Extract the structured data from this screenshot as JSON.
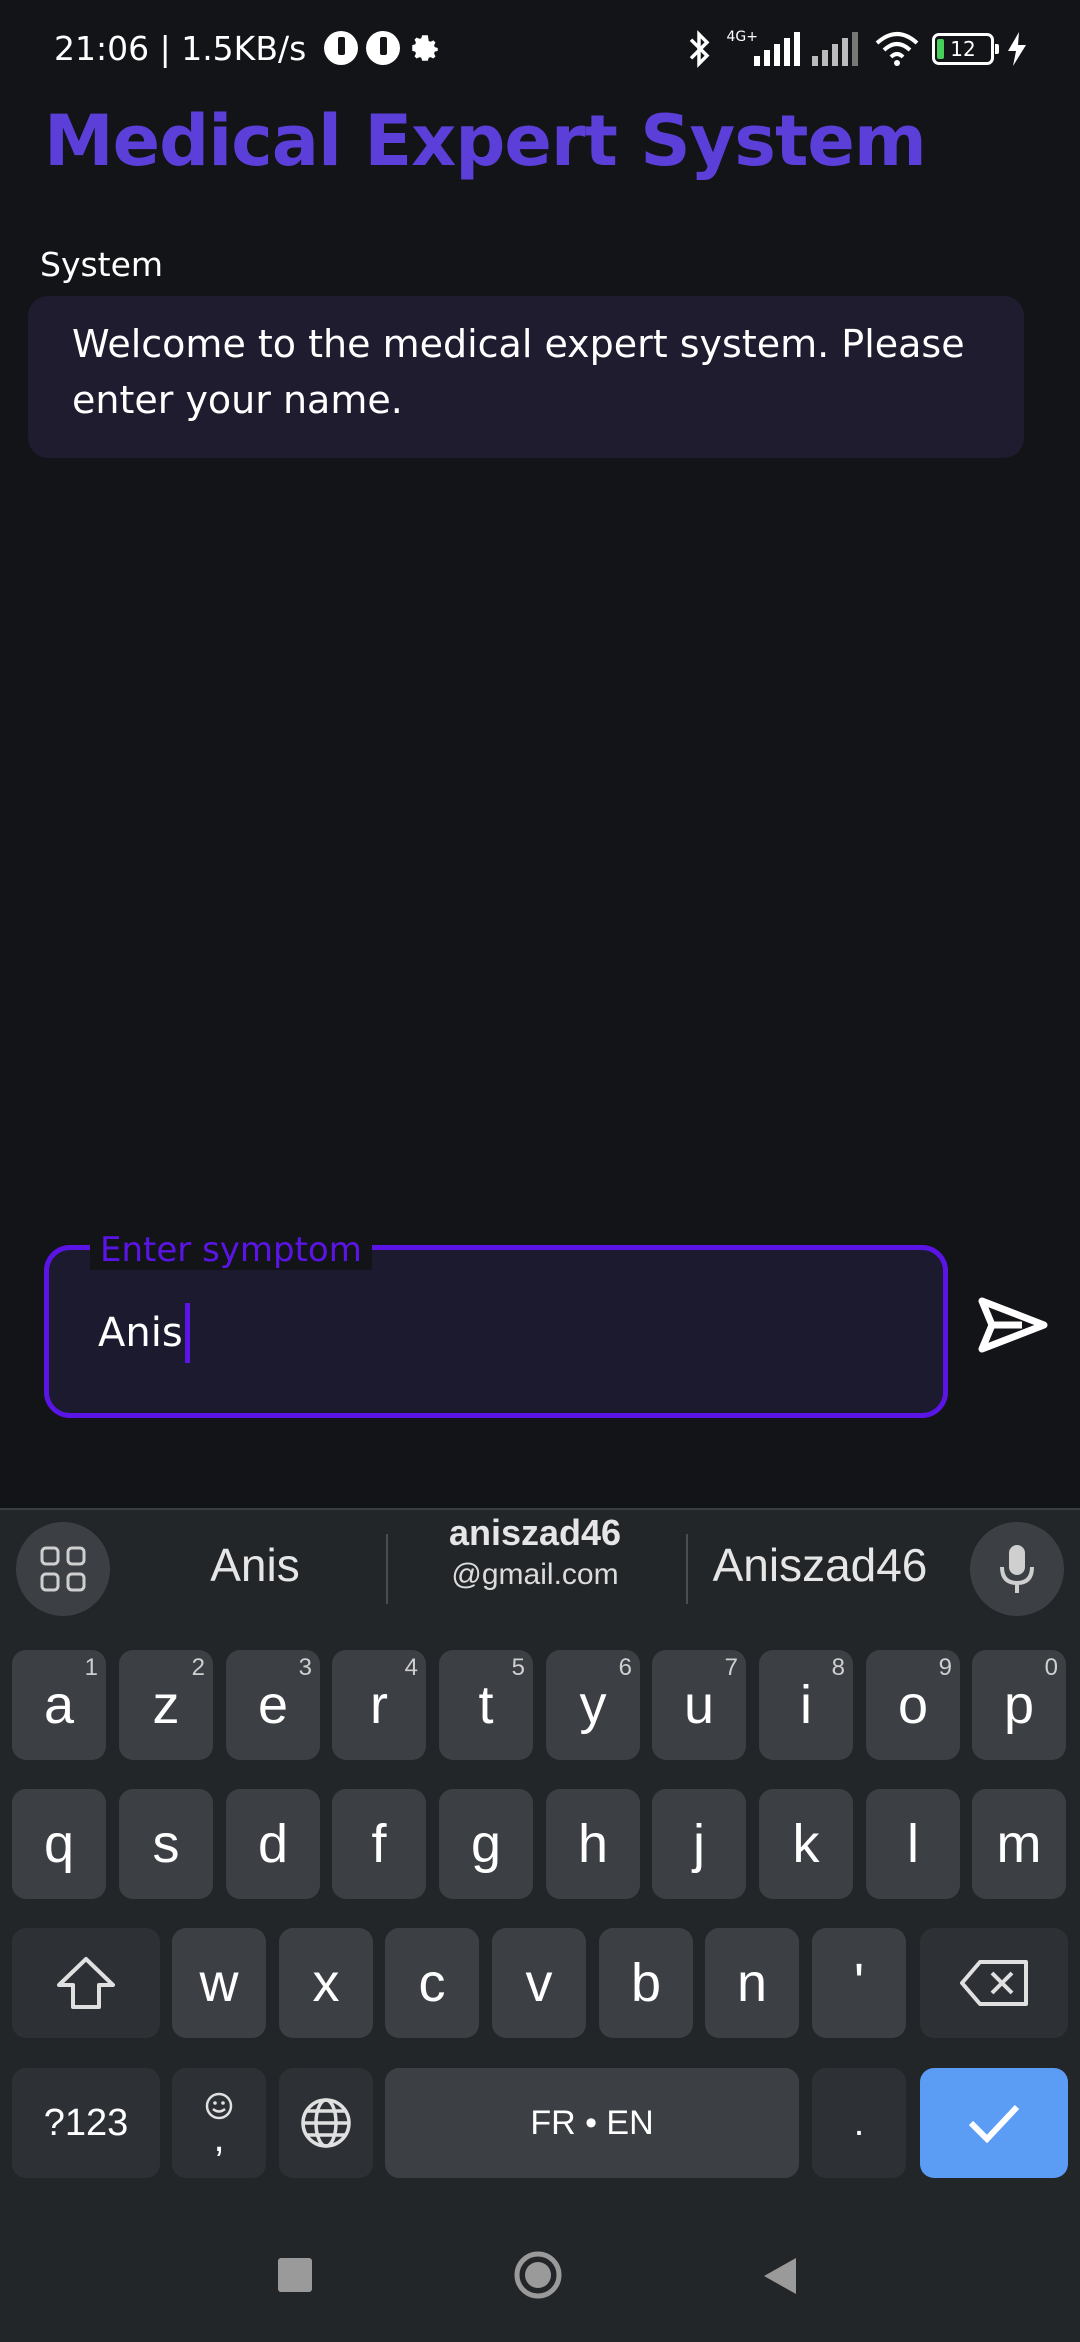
{
  "status_bar": {
    "time_speed": "21:06 | 1.5KB/s",
    "network": "4G+",
    "battery": "12"
  },
  "app": {
    "title": "Medical Expert System"
  },
  "chat": {
    "messages": [
      {
        "sender": "System",
        "text": "Welcome to the medical expert system. Please enter your name."
      }
    ]
  },
  "input": {
    "label": "Enter symptom",
    "value": "Anis"
  },
  "keyboard": {
    "suggestions": {
      "first": "Anis",
      "middle_main": "aniszad46",
      "middle_sub": "@gmail.com",
      "third": "Aniszad46"
    },
    "row1": [
      {
        "k": "a",
        "n": "1"
      },
      {
        "k": "z",
        "n": "2"
      },
      {
        "k": "e",
        "n": "3"
      },
      {
        "k": "r",
        "n": "4"
      },
      {
        "k": "t",
        "n": "5"
      },
      {
        "k": "y",
        "n": "6"
      },
      {
        "k": "u",
        "n": "7"
      },
      {
        "k": "i",
        "n": "8"
      },
      {
        "k": "o",
        "n": "9"
      },
      {
        "k": "p",
        "n": "0"
      }
    ],
    "row2": [
      "q",
      "s",
      "d",
      "f",
      "g",
      "h",
      "j",
      "k",
      "l",
      "m"
    ],
    "row3": [
      "w",
      "x",
      "c",
      "v",
      "b",
      "n",
      "'"
    ],
    "symbols_label": "?123",
    "comma_label": ",",
    "space_label": "FR • EN",
    "period_label": "."
  },
  "colors": {
    "accent": "#5a14e6",
    "title": "#5b3fd8",
    "enter_key": "#5b9cf4"
  }
}
